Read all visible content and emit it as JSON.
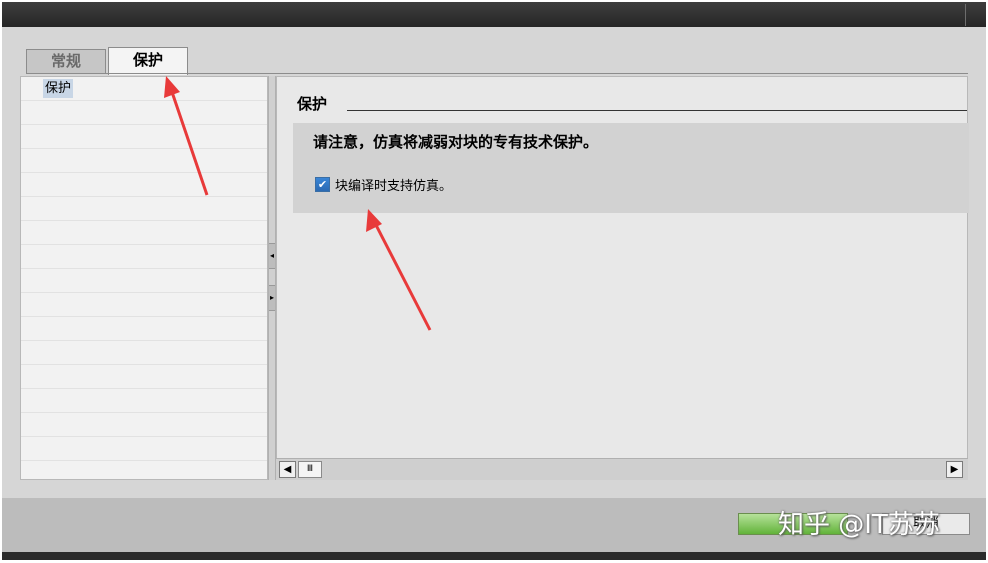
{
  "tabs": [
    {
      "label": "常规",
      "active": false
    },
    {
      "label": "保护",
      "active": true
    }
  ],
  "nav": {
    "items": [
      {
        "label": "保护",
        "selected": true
      }
    ]
  },
  "protection": {
    "title": "保护",
    "notice": "请注意，仿真将减弱对块的专有技术保护。",
    "checkbox_label": "块编译时支持仿真。",
    "checkbox_checked": true
  },
  "scroll": {
    "left_icon": "chevron-left-icon",
    "right_icon": "chevron-right-icon",
    "thumb_glyph": "Ⅲ"
  },
  "footer": {
    "cancel_label": "取消"
  },
  "watermark": "知乎 @IT苏苏",
  "colors": {
    "annotation_arrow": "#e83a3a",
    "ok_button": "#62b33a",
    "checkbox": "#2b6ab3"
  }
}
